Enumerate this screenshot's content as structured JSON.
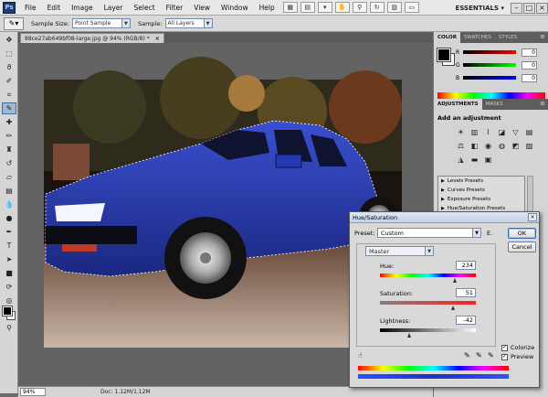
{
  "app": {
    "logo": "Ps",
    "workspace": "ESSENTIALS ▾"
  },
  "menu": [
    "File",
    "Edit",
    "Image",
    "Layer",
    "Select",
    "Filter",
    "View",
    "Window",
    "Help"
  ],
  "options_bar": {
    "sample_size_label": "Sample Size:",
    "sample_size_value": "Point Sample",
    "sample_label": "Sample:",
    "sample_value": "All Layers"
  },
  "document": {
    "tab_title": "88ce27ab649bf08-large.jpg @ 94% (RGB/8) *",
    "zoom": "94%",
    "doc_info": "Doc: 1.12M/1.12M"
  },
  "panels": {
    "top_tabs": [
      "COLOR",
      "SWATCHES",
      "STYLES"
    ],
    "color": {
      "r_label": "R",
      "g_label": "G",
      "b_label": "B",
      "r": "0",
      "g": "0",
      "b": "0"
    },
    "mid_tabs": [
      "ADJUSTMENTS",
      "MASKS"
    ],
    "adjustments": {
      "title": "Add an adjustment",
      "presets": [
        "Levels Presets",
        "Curves Presets",
        "Exposure Presets",
        "Hue/Saturation Presets"
      ]
    }
  },
  "dialog": {
    "title": "Hue/Saturation",
    "preset_label": "Preset:",
    "preset_value": "Custom",
    "preset_menu": "E.",
    "ok": "OK",
    "cancel": "Cancel",
    "channel": "Master",
    "hue_label": "Hue:",
    "hue": "234",
    "saturation_label": "Saturation:",
    "saturation": "51",
    "lightness_label": "Lightness:",
    "lightness": "-42",
    "colorize": "Colorize",
    "preview": "Preview",
    "colorize_checked": true,
    "preview_checked": true
  }
}
